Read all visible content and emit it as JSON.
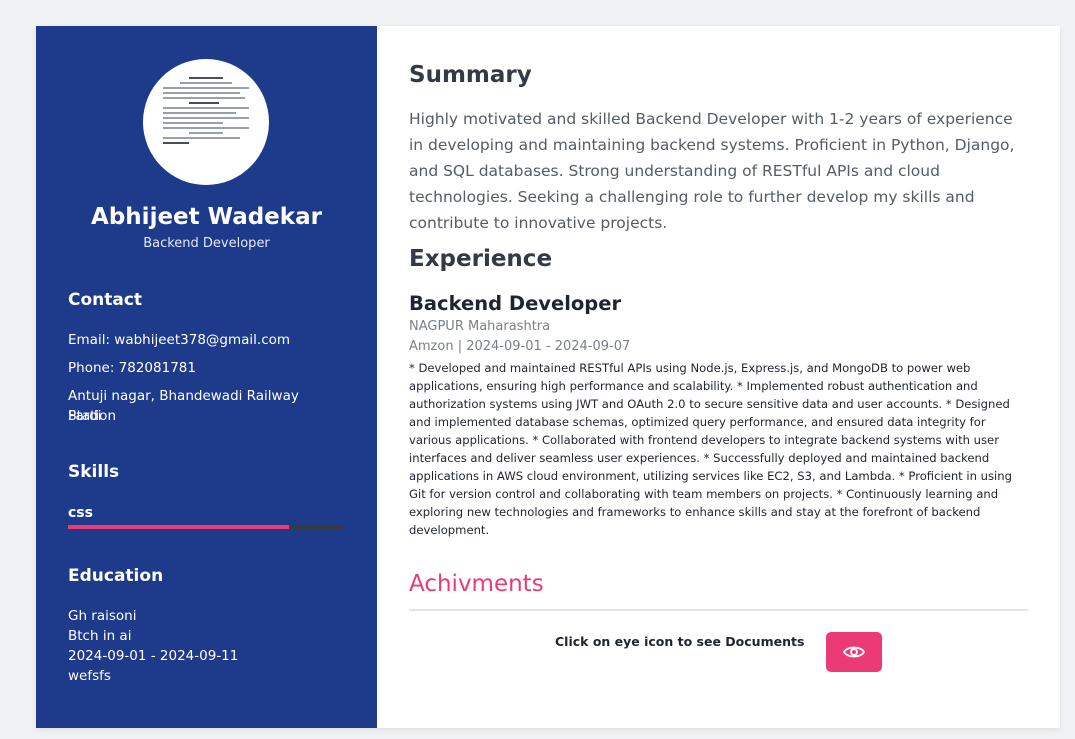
{
  "profile": {
    "name": "Abhijeet Wadekar",
    "role": "Backend Developer"
  },
  "contact": {
    "title": "Contact",
    "email": "Email: wabhijeet378@gmail.com",
    "phone": "Phone: 782081781",
    "address_line1": "Antuji nagar, Bhandewadi Railway Station",
    "address_line2": "Pardi"
  },
  "skills": {
    "title": "Skills",
    "items": [
      {
        "name": "css",
        "level_percent": 80
      }
    ],
    "colors": {
      "fill": "#ec3a77",
      "track": "#3a3a3a"
    }
  },
  "education": {
    "title": "Education",
    "school": "Gh raisoni",
    "degree": "Btch in ai",
    "dates": "2024-09-01 - 2024-09-11",
    "note": "wefsfs"
  },
  "summary": {
    "title": "Summary",
    "text": "Highly motivated and skilled Backend Developer with 1-2 years of experience in developing and maintaining backend systems. Proficient in Python, Django, and SQL databases. Strong understanding of RESTful APIs and cloud technologies. Seeking a challenging role to further develop my skills and contribute to innovative projects."
  },
  "experience": {
    "title": "Experience",
    "jobs": [
      {
        "title": "Backend Developer",
        "location": "NAGPUR Maharashtra",
        "company_dates": "Amzon | 2024-09-01 - 2024-09-07",
        "description": "* Developed and maintained RESTful APIs using Node.js, Express.js, and MongoDB to power web applications, ensuring high performance and scalability. * Implemented robust authentication and authorization systems using JWT and OAuth 2.0 to secure sensitive data and user accounts. * Designed and implemented database schemas, optimized query performance, and ensured data integrity for various applications. * Collaborated with frontend developers to integrate backend systems with user interfaces and deliver seamless user experiences. * Successfully deployed and maintained backend applications in AWS cloud environment, utilizing services like EC2, S3, and Lambda. * Proficient in using Git for version control and collaborating with team members on projects. * Continuously learning and exploring new technologies and frameworks to enhance skills and stay at the forefront of backend development."
      }
    ]
  },
  "achievements": {
    "title": "Achivments",
    "hint": "Click on eye icon to see Documents",
    "button_icon": "eye-icon"
  },
  "theme": {
    "sidebar_bg": "#1e3a8a",
    "accent": "#ec3a77"
  }
}
